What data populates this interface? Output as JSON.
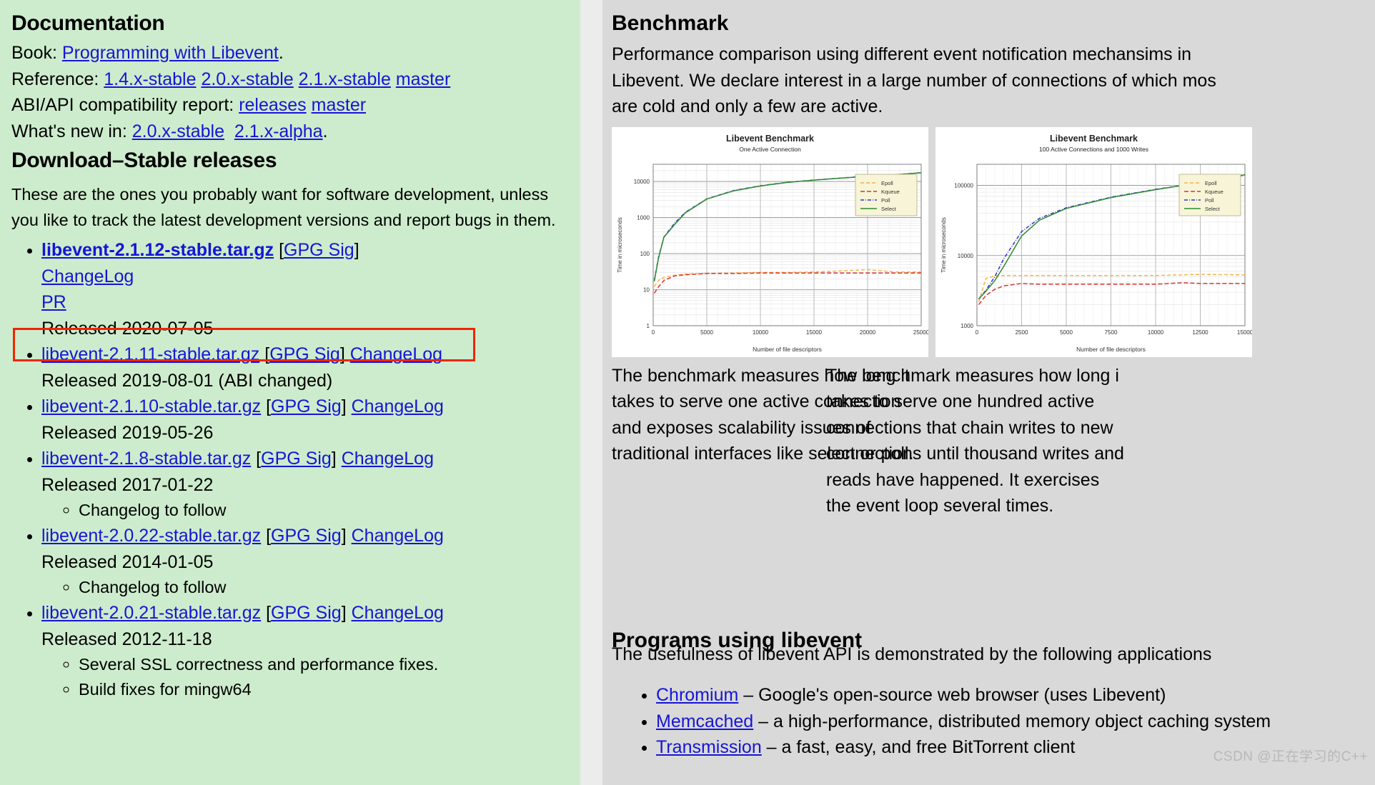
{
  "left": {
    "documentation": {
      "heading": "Documentation",
      "book_label": "Book:",
      "book_link": "Programming with Libevent",
      "book_suffix": ".",
      "reference_label": "Reference:",
      "reference_links": [
        "1.4.x-stable",
        "2.0.x-stable",
        "2.1.x-stable",
        "master"
      ],
      "abi_label": "ABI/API compatibility report:",
      "abi_links": [
        "releases",
        "master"
      ],
      "whatsnew_label": "What's new in:",
      "whatsnew_links": [
        "2.0.x-stable",
        "2.1.x-alpha"
      ],
      "whatsnew_suffix": "."
    },
    "download": {
      "heading": "Download–Stable releases",
      "intro": "These are the ones you probably want for software development, unless you like to track the latest development versions and report bugs in them.",
      "gpg_label": "GPG Sig",
      "changelog_label": "ChangeLog",
      "pr_label": "PR",
      "releases": [
        {
          "file": "libevent-2.1.12-stable.tar.gz",
          "gpg": "GPG Sig",
          "changelog": "ChangeLog",
          "pr": "PR",
          "released": "Released 2020-07-05",
          "notes": [],
          "highlighted": true
        },
        {
          "file": "libevent-2.1.11-stable.tar.gz",
          "gpg": "GPG Sig",
          "changelog": "ChangeLog",
          "released": "Released 2019-08-01 (ABI changed)",
          "notes": [],
          "highlighted": false
        },
        {
          "file": "libevent-2.1.10-stable.tar.gz",
          "gpg": "GPG Sig",
          "changelog": "ChangeLog",
          "released": "Released 2019-05-26",
          "notes": [],
          "highlighted": false
        },
        {
          "file": "libevent-2.1.8-stable.tar.gz",
          "gpg": "GPG Sig",
          "changelog": "ChangeLog",
          "released": "Released 2017-01-22",
          "notes": [
            "Changelog to follow"
          ],
          "highlighted": false
        },
        {
          "file": "libevent-2.0.22-stable.tar.gz",
          "gpg": "GPG Sig",
          "changelog": "ChangeLog",
          "released": "Released 2014-01-05",
          "notes": [
            "Changelog to follow"
          ],
          "highlighted": false
        },
        {
          "file": "libevent-2.0.21-stable.tar.gz",
          "gpg": "GPG Sig",
          "changelog": "ChangeLog",
          "released": "Released 2012-11-18",
          "notes": [
            "Several SSL correctness and performance fixes.",
            "Build fixes for mingw64"
          ],
          "highlighted": false
        }
      ]
    }
  },
  "right": {
    "benchmark": {
      "heading": "Benchmark",
      "description_lines": [
        "Performance comparison using different event notification mechansims in",
        "Libevent. We declare interest in a large number of connections of which mos",
        "are cold and only a few are active."
      ],
      "caption_1_lines": [
        "The benchmark measures how long it",
        "takes to serve one active connection",
        "and exposes scalability issues of",
        "traditional interfaces like select or poll."
      ],
      "caption_2_lines": [
        "The benchmark measures how long i",
        "takes to serve one hundred active",
        "connections that chain writes to new",
        "connections until thousand writes and",
        "reads have happened. It exercises",
        "the event loop several times."
      ]
    },
    "programs": {
      "heading": "Programs using libevent",
      "description": "The usefulness of libevent API is demonstrated by the following applications",
      "items": [
        {
          "name": "Chromium",
          "desc": "– Google's open-source web browser (uses Libevent)"
        },
        {
          "name": "Memcached",
          "desc": "– a high-performance, distributed memory object caching system"
        },
        {
          "name": "Transmission",
          "desc": "– a fast, easy, and free BitTorrent client"
        }
      ]
    }
  },
  "watermark": "CSDN @正在学习的C++",
  "colors": {
    "left_panel_bg": "#cdeccd",
    "right_panel_bg": "#d9d9d9",
    "link": "#1515d6",
    "highlight_box": "#f02500",
    "legend_bg": "#f7f4d8",
    "epoll": "#f2b44a",
    "kqueue": "#e03030",
    "poll": "#3333cc",
    "select": "#2e8b2e"
  },
  "chart_data": [
    {
      "type": "line",
      "title": "Libevent Benchmark",
      "subtitle": "One Active Connection",
      "xlabel": "Number of file descriptors",
      "ylabel": "Time in microseconds",
      "xlim": [
        0,
        25000
      ],
      "ylim": [
        1,
        30000
      ],
      "yscale": "log",
      "xticks": [
        0,
        5000,
        10000,
        15000,
        20000,
        25000
      ],
      "yticks": [
        1,
        10,
        100,
        1000,
        10000
      ],
      "grid": true,
      "legend_position": "upper right",
      "x": [
        100,
        500,
        1000,
        2000,
        3000,
        5000,
        7500,
        10000,
        12500,
        15000,
        17500,
        20000,
        22500,
        25000
      ],
      "series": [
        {
          "name": "Epoll",
          "color": "#f2b44a",
          "values": [
            12,
            18,
            22,
            25,
            27,
            28,
            29,
            30,
            30,
            31,
            33,
            36,
            31,
            31
          ]
        },
        {
          "name": "Kqueue",
          "color": "#e03030",
          "values": [
            8,
            12,
            18,
            24,
            26,
            28,
            28,
            29,
            29,
            29,
            29,
            29,
            29,
            29
          ]
        },
        {
          "name": "Poll",
          "color": "#3333cc",
          "values": [
            18,
            80,
            290,
            700,
            1400,
            3300,
            5600,
            7600,
            9500,
            11000,
            12500,
            14000,
            15500,
            17500
          ]
        },
        {
          "name": "Select",
          "color": "#2e8b2e",
          "values": [
            17,
            75,
            285,
            640,
            1350,
            3250,
            5500,
            7500,
            9400,
            10900,
            12400,
            13900,
            15400,
            17400
          ]
        }
      ]
    },
    {
      "type": "line",
      "title": "Libevent Benchmark",
      "subtitle": "100 Active Connections and 1000 Writes",
      "xlabel": "Number of file descriptors",
      "ylabel": "Time in microseconds",
      "xlim": [
        0,
        15000
      ],
      "ylim": [
        1000,
        200000
      ],
      "yscale": "log",
      "xticks": [
        0,
        2500,
        5000,
        7500,
        10000,
        12500,
        15000
      ],
      "yticks": [
        1000,
        10000,
        100000
      ],
      "grid": true,
      "legend_position": "upper right",
      "x": [
        100,
        500,
        1000,
        1500,
        2500,
        3500,
        5000,
        7500,
        10000,
        11500,
        12500,
        15000
      ],
      "series": [
        {
          "name": "Epoll",
          "color": "#f2b44a",
          "values": [
            2200,
            4700,
            5100,
            5200,
            5200,
            5200,
            5200,
            5200,
            5200,
            5300,
            5400,
            5300
          ]
        },
        {
          "name": "Kqueue",
          "color": "#e03030",
          "values": [
            2000,
            2700,
            3300,
            3700,
            4000,
            3900,
            3900,
            3900,
            3900,
            4100,
            4000,
            4000
          ]
        },
        {
          "name": "Poll",
          "color": "#3333cc",
          "values": [
            2400,
            3200,
            5000,
            9000,
            22000,
            34000,
            48000,
            68000,
            88000,
            100000,
            112000,
            140000
          ]
        },
        {
          "name": "Select",
          "color": "#2e8b2e",
          "values": [
            2400,
            3100,
            4400,
            7000,
            19000,
            32000,
            47000,
            67000,
            87000,
            100000,
            113000,
            142000
          ]
        }
      ]
    }
  ]
}
